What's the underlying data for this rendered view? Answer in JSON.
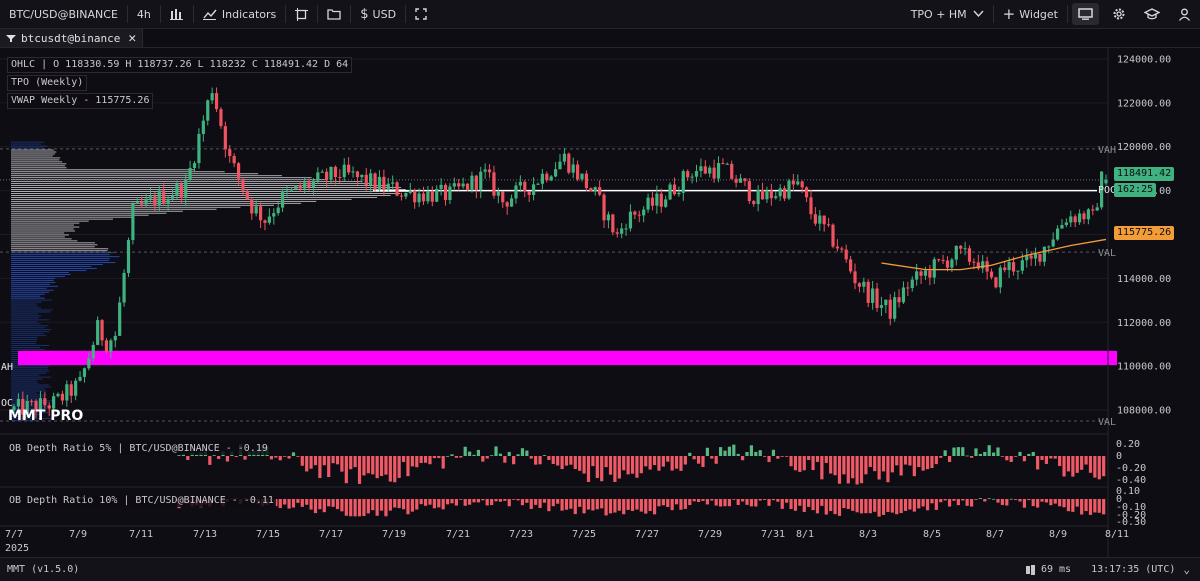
{
  "toolbar": {
    "symbol": "BTC/USD@BINANCE",
    "timeframe": "4h",
    "indicators_label": "Indicators",
    "currency_label": "USD",
    "tpo_label": "TPO + HM",
    "widget_label": "Widget"
  },
  "tab": {
    "label": "btcusdt@binance"
  },
  "legend": {
    "ohlc": "OHLC | O 118330.59 H 118737.26 L 118232 C 118491.42 D 64",
    "tpo": "TPO (Weekly)",
    "vwap": "VWAP Weekly - 115775.26"
  },
  "logo": "MMT PRO",
  "markers": {
    "vah": "VAH",
    "poc": "POC",
    "val": "VAL",
    "left_vah": "AH",
    "left_poc": "OC"
  },
  "price_labels": {
    "last": "118491.42",
    "countdown": "162:25",
    "vwap": "115775.26"
  },
  "sub_legends": {
    "ob5": "OB Depth Ratio 5% | BTC/USD@BINANCE - -0.19",
    "ob10": "OB Depth Ratio 10% | BTC/USD@BINANCE - -0.11"
  },
  "year": "2025",
  "status": {
    "version": "MMT (v1.5.0)",
    "latency": "69 ms",
    "clock": "13:17:35 (UTC)"
  },
  "colors": {
    "up": "#3fb27f",
    "down": "#f0525f",
    "vwap": "#f29d38",
    "band": "#ff00ff",
    "profile_value": "#d9d9dd",
    "profile_blue": "#2c57d8",
    "profile_dark": "#1c3a8a",
    "ob_up": "#57b884",
    "ob_down": "#ef5a66"
  },
  "chart_data": [
    {
      "type": "candlestick",
      "title": "BTC/USD@BINANCE 4h",
      "x_ticks": [
        "7/7",
        "7/9",
        "7/11",
        "7/13",
        "7/15",
        "7/17",
        "7/19",
        "7/21",
        "7/23",
        "7/25",
        "7/27",
        "7/29",
        "7/31",
        "8/1",
        "8/3",
        "8/5",
        "8/7",
        "8/9",
        "8/11"
      ],
      "y_ticks": [
        "124000.00",
        "122000.00",
        "120000.00",
        "118000.00",
        "116000.00",
        "114000.00",
        "112000.00",
        "110000.00",
        "108000.00"
      ],
      "ylim": [
        107000,
        124500
      ],
      "levels": {
        "vah": 119900,
        "poc": 118000,
        "val": 115200,
        "lower_val": 107500,
        "last_price": 118491.42,
        "band_low": 110050,
        "band_high": 110700
      },
      "waypoints": [
        [
          0,
          108000
        ],
        [
          10,
          108300
        ],
        [
          16,
          109200
        ],
        [
          20,
          111700
        ],
        [
          22,
          111100
        ],
        [
          24,
          111400
        ],
        [
          28,
          117000
        ],
        [
          33,
          117600
        ],
        [
          40,
          118200
        ],
        [
          46,
          122700
        ],
        [
          50,
          119400
        ],
        [
          55,
          117300
        ],
        [
          58,
          116700
        ],
        [
          62,
          117700
        ],
        [
          68,
          118300
        ],
        [
          75,
          118800
        ],
        [
          80,
          118500
        ],
        [
          90,
          117900
        ],
        [
          100,
          117800
        ],
        [
          108,
          118700
        ],
        [
          112,
          117500
        ],
        [
          118,
          118200
        ],
        [
          126,
          119500
        ],
        [
          133,
          117800
        ],
        [
          138,
          115900
        ],
        [
          140,
          116700
        ],
        [
          148,
          117600
        ],
        [
          155,
          118900
        ],
        [
          162,
          119000
        ],
        [
          170,
          117600
        ],
        [
          179,
          118300
        ],
        [
          182,
          117000
        ],
        [
          188,
          115500
        ],
        [
          192,
          114000
        ],
        [
          196,
          113100
        ],
        [
          200,
          112500
        ],
        [
          204,
          113700
        ],
        [
          210,
          114500
        ],
        [
          215,
          115100
        ],
        [
          220,
          114800
        ],
        [
          223,
          113700
        ],
        [
          226,
          114500
        ],
        [
          232,
          114700
        ],
        [
          236,
          115700
        ],
        [
          240,
          116800
        ],
        [
          244,
          116900
        ],
        [
          246,
          116700
        ],
        [
          248,
          118491
        ]
      ],
      "ohlc_last": {
        "open": 118330.59,
        "high": 118737.26,
        "low": 118232,
        "close": 118491.42
      }
    },
    {
      "type": "line",
      "name": "VWAP Weekly",
      "points": [
        [
          197,
          114700
        ],
        [
          207,
          114400
        ],
        [
          215,
          114400
        ],
        [
          222,
          114600
        ],
        [
          230,
          115050
        ],
        [
          240,
          115500
        ],
        [
          248,
          115775.26
        ]
      ]
    },
    {
      "type": "profile",
      "name": "TPO (Weekly)",
      "price_range": [
        107500,
        120200
      ],
      "note": "horizontal volume/TPO profile on left edge"
    },
    {
      "type": "bar",
      "name": "OB Depth Ratio 5%",
      "y_ticks": [
        "0.20",
        "0",
        "-0.20",
        "-0.40"
      ],
      "ylim": [
        -0.45,
        0.25
      ],
      "last": -0.19
    },
    {
      "type": "bar",
      "name": "OB Depth Ratio 10%",
      "y_ticks": [
        "0.10",
        "0",
        "-0.10",
        "-0.20",
        "-0.30"
      ],
      "ylim": [
        -0.32,
        0.12
      ],
      "last": -0.11
    }
  ]
}
